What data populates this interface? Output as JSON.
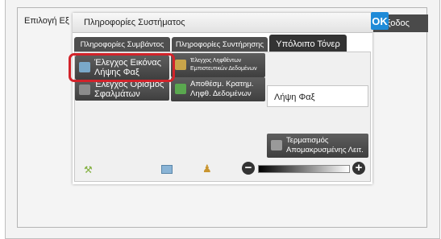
{
  "header": {
    "breadcrumb_text": "Επιλογή Εξ",
    "exit_label": "Έξοδος"
  },
  "dialog": {
    "title": "Πληροφορίες Συστήματος",
    "ok_label": "OK"
  },
  "tabs": [
    {
      "label": "Πληροφορίες Συμβάντος"
    },
    {
      "label": "Πληροφορίες Συντήρησης"
    },
    {
      "label": "Υπόλοιπο Τόνερ"
    }
  ],
  "functions": {
    "fax_image_check": "Έλεγχος Εικόνας Λήψης Φαξ",
    "received_data_check": "Έλεγχος Ληφθέντων Εμπιστευτικών Δεδομένων",
    "error_check": "Έλεγχος Ορισμός Σφαλμάτων",
    "save_received_data": "Αποθέσμ. Κρατημ. Ληφθ. Δεδομένων",
    "fax_reception": "Λήψη Φαξ",
    "end_remote_operation": "Τερματισμός Απομακρυσμένης Λειτ."
  },
  "colors": {
    "highlight": "#d2232a",
    "ok_button": "#1f8bd8"
  },
  "icons": [
    "wrench-icon",
    "document-icon",
    "person-icon",
    "minus-icon",
    "plus-icon"
  ]
}
